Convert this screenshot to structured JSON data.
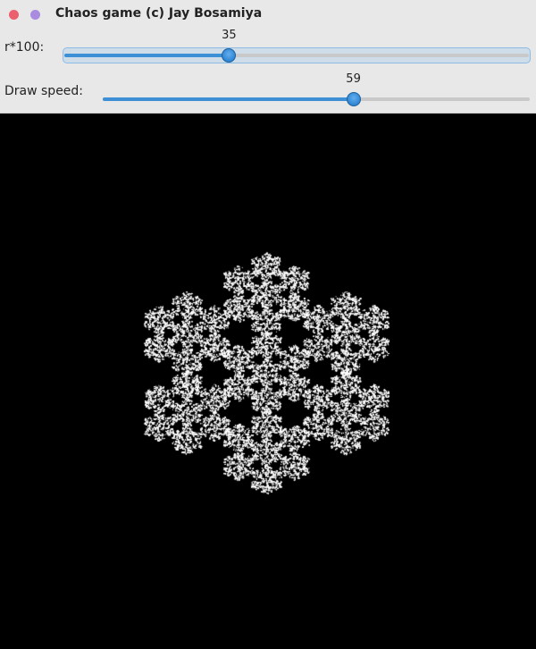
{
  "window": {
    "title": "Chaos game (c) Jay Bosamiya",
    "close_color": "#ec5f6f",
    "minimize_color": "#a98be0"
  },
  "controls": {
    "r": {
      "label": "r*100:",
      "value": 35,
      "min": 0,
      "max": 100
    },
    "speed": {
      "label": "Draw speed:",
      "value": 59,
      "min": 0,
      "max": 100
    }
  },
  "canvas": {
    "background": "#000000",
    "point_color": "#ffffff"
  }
}
